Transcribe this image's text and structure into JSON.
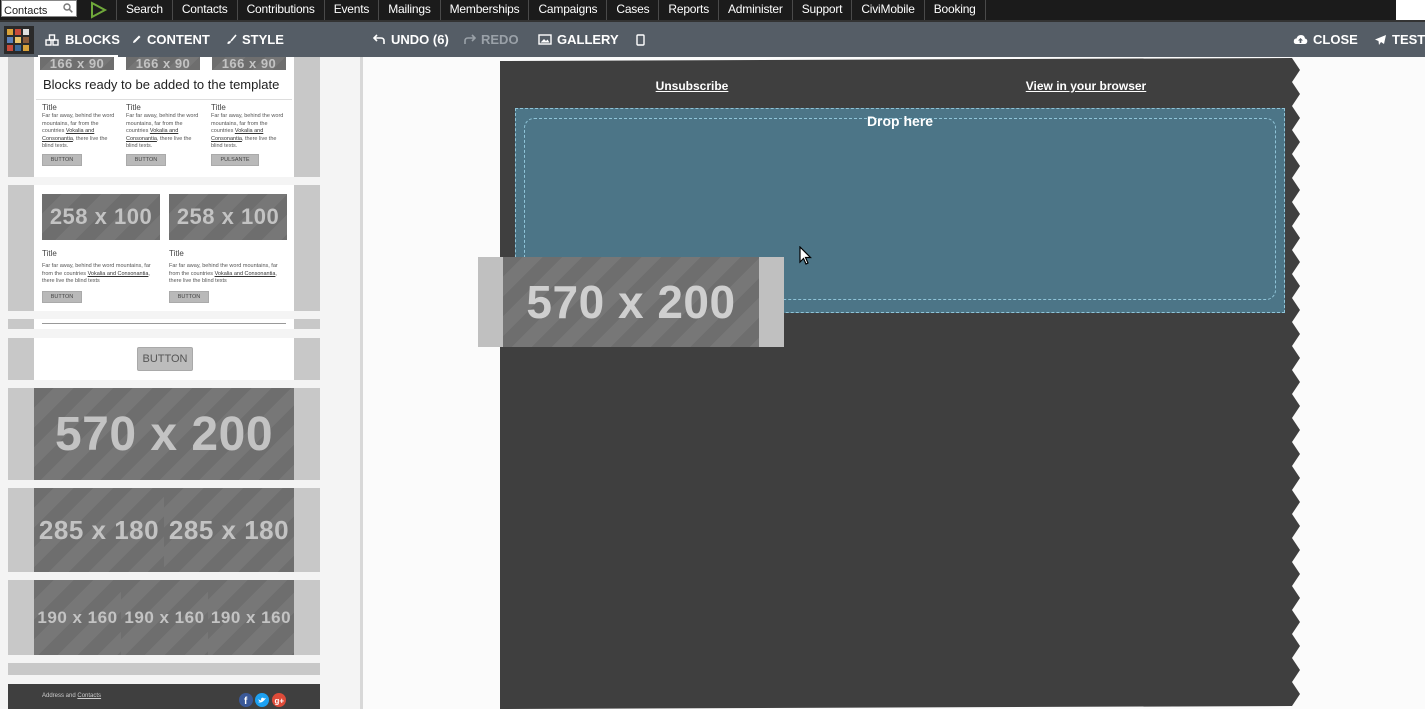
{
  "civi_menu": {
    "search_placeholder": "Contacts",
    "items": [
      "Search",
      "Contacts",
      "Contributions",
      "Events",
      "Mailings",
      "Memberships",
      "Campaigns",
      "Cases",
      "Reports",
      "Administer",
      "Support",
      "CiviMobile",
      "Booking"
    ]
  },
  "toolbar": {
    "blocks": "BLOCKS",
    "content": "CONTENT",
    "style": "STYLE",
    "undo": "UNDO (6)",
    "redo": "REDO",
    "gallery": "GALLERY",
    "close": "CLOSE",
    "test": "TEST"
  },
  "left_panel": {
    "tooltip": "Blocks ready to be added to the template",
    "triple_block": {
      "top_placeholder": "166 x 90",
      "columns": [
        {
          "title": "Title",
          "text": "Far far away, behind the word mountains, far from the countries",
          "links": [
            "Vokalia and",
            "Consonantia"
          ],
          "text_end": ", there live the blind texts.",
          "button": "BUTTON"
        },
        {
          "title": "Title",
          "text": "Far far away, behind the word mountains, far from the countries",
          "links": [
            "Vokalia and",
            "Consonantia"
          ],
          "text_end": ", there live the blind texts.",
          "button": "BUTTON"
        },
        {
          "title": "Title",
          "text": "Far far away, behind the word mountains, far from the countries",
          "links": [
            "Vokalia and",
            "Consonantia"
          ],
          "text_end": ", there live the blind texts.",
          "button": "PULSANTE"
        }
      ]
    },
    "double_block": {
      "placeholder": "258 x 100",
      "columns": [
        {
          "title": "Title",
          "text": "Far far away, behind the word mountains, far from the countries",
          "link": "Vokalia and Consonantia",
          "text_end": ", there live the blind texts",
          "button": "BUTTON"
        },
        {
          "title": "Title",
          "text": "Far far away, behind the word mountains, far from the countries",
          "link": "Vokalia and Consonantia",
          "text_end": ", there live the blind texts",
          "button": "BUTTON"
        }
      ]
    },
    "button_block": "BUTTON",
    "image_block": "570 x 200",
    "double_image": "285 x 180",
    "triple_image": "190 x 160",
    "footer": {
      "address": "Address and",
      "contacts_link": "Contacts"
    }
  },
  "email": {
    "unsubscribe": "Unsubscribe",
    "view_browser": "View in your browser",
    "drop_here": "Drop here",
    "dragged_block": "570 x 200"
  },
  "colors": {
    "menu_bg": "#1b1b1b",
    "toolbar_bg": "#555d66",
    "email_bg": "#3f3f3f",
    "drop_zone": "#4c7587"
  }
}
